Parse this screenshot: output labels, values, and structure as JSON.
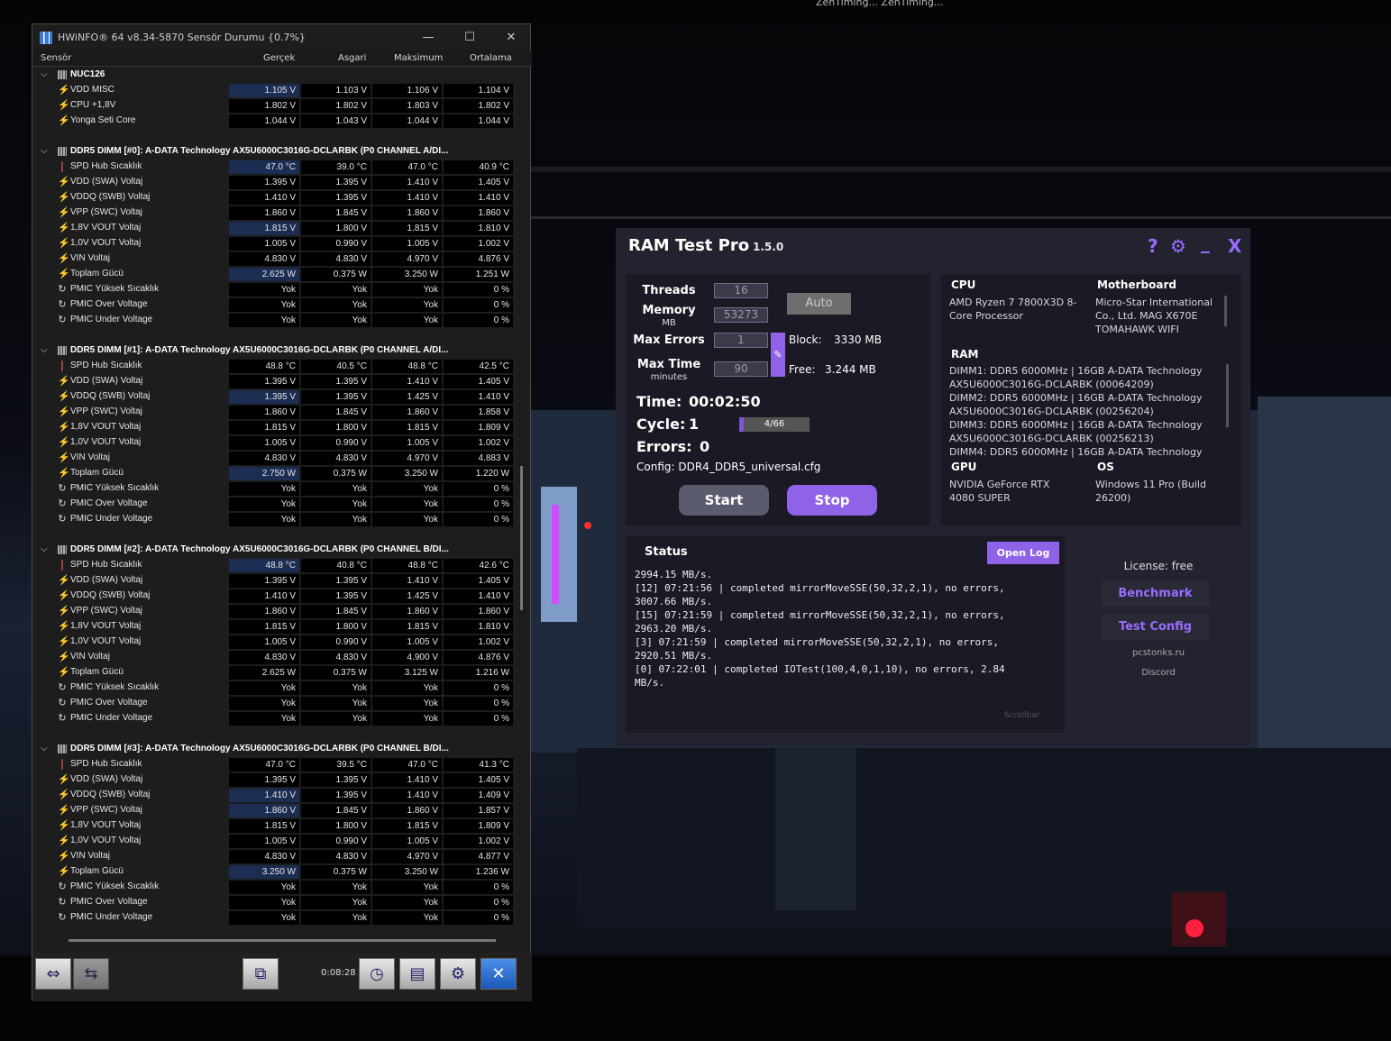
{
  "desktop": {
    "top_text": "ZenTiming...  ZenTiming..."
  },
  "hwinfo": {
    "title": "HWiNFO® 64 v8.34-5870 Sensör Durumu {0.7%}",
    "columns": [
      "Sensör",
      "Gerçek",
      "Asgari",
      "Maksimum",
      "Ortalama"
    ],
    "groups": [
      {
        "name": "NUC126",
        "rows": [
          {
            "i": "bolt",
            "n": "VDD MISC",
            "v": [
              "1.105 V",
              "1.103 V",
              "1.106 V",
              "1.104 V"
            ],
            "h": true
          },
          {
            "i": "bolt",
            "n": "CPU +1,8V",
            "v": [
              "1.802 V",
              "1.802 V",
              "1.803 V",
              "1.802 V"
            ]
          },
          {
            "i": "bolt",
            "n": "Yonga Seti Core",
            "v": [
              "1.044 V",
              "1.043 V",
              "1.044 V",
              "1.044 V"
            ]
          }
        ]
      },
      {
        "name": "DDR5 DIMM [#0]: A-DATA Technology AX5U6000C3016G-DCLARBK (P0 CHANNEL A/DI...",
        "rows": [
          {
            "i": "therm",
            "n": "SPD Hub Sıcaklık",
            "v": [
              "47.0 °C",
              "39.0 °C",
              "47.0 °C",
              "40.9 °C"
            ],
            "h": true
          },
          {
            "i": "bolt",
            "n": "VDD (SWA) Voltaj",
            "v": [
              "1.395 V",
              "1.395 V",
              "1.410 V",
              "1.405 V"
            ]
          },
          {
            "i": "bolt",
            "n": "VDDQ (SWB) Voltaj",
            "v": [
              "1.410 V",
              "1.395 V",
              "1.410 V",
              "1.410 V"
            ]
          },
          {
            "i": "bolt",
            "n": "VPP (SWC) Voltaj",
            "v": [
              "1.860 V",
              "1.845 V",
              "1.860 V",
              "1.860 V"
            ]
          },
          {
            "i": "bolt",
            "n": "1,8V VOUT Voltaj",
            "v": [
              "1.815 V",
              "1.800 V",
              "1.815 V",
              "1.810 V"
            ],
            "h": true
          },
          {
            "i": "bolt",
            "n": "1,0V VOUT Voltaj",
            "v": [
              "1.005 V",
              "0.990 V",
              "1.005 V",
              "1.002 V"
            ]
          },
          {
            "i": "bolt",
            "n": "VIN Voltaj",
            "v": [
              "4.830 V",
              "4.830 V",
              "4.970 V",
              "4.876 V"
            ]
          },
          {
            "i": "bolt",
            "n": "Toplam Gücü",
            "v": [
              "2.625 W",
              "0.375 W",
              "3.250 W",
              "1.251 W"
            ],
            "h": true
          },
          {
            "i": "circ",
            "n": "PMIC Yüksek Sıcaklık",
            "v": [
              "Yok",
              "Yok",
              "Yok",
              "0 %"
            ]
          },
          {
            "i": "circ",
            "n": "PMIC Over Voltage",
            "v": [
              "Yok",
              "Yok",
              "Yok",
              "0 %"
            ]
          },
          {
            "i": "circ",
            "n": "PMIC Under Voltage",
            "v": [
              "Yok",
              "Yok",
              "Yok",
              "0 %"
            ]
          }
        ]
      },
      {
        "name": "DDR5 DIMM [#1]: A-DATA Technology AX5U6000C3016G-DCLARBK (P0 CHANNEL A/DI...",
        "rows": [
          {
            "i": "therm",
            "n": "SPD Hub Sıcaklık",
            "v": [
              "48.8 °C",
              "40.5 °C",
              "48.8 °C",
              "42.5 °C"
            ]
          },
          {
            "i": "bolt",
            "n": "VDD (SWA) Voltaj",
            "v": [
              "1.395 V",
              "1.395 V",
              "1.410 V",
              "1.405 V"
            ]
          },
          {
            "i": "bolt",
            "n": "VDDQ (SWB) Voltaj",
            "v": [
              "1.395 V",
              "1.395 V",
              "1.425 V",
              "1.410 V"
            ],
            "h": true
          },
          {
            "i": "bolt",
            "n": "VPP (SWC) Voltaj",
            "v": [
              "1.860 V",
              "1.845 V",
              "1.860 V",
              "1.858 V"
            ]
          },
          {
            "i": "bolt",
            "n": "1,8V VOUT Voltaj",
            "v": [
              "1.815 V",
              "1.800 V",
              "1.815 V",
              "1.809 V"
            ]
          },
          {
            "i": "bolt",
            "n": "1,0V VOUT Voltaj",
            "v": [
              "1.005 V",
              "0.990 V",
              "1.005 V",
              "1.002 V"
            ]
          },
          {
            "i": "bolt",
            "n": "VIN Voltaj",
            "v": [
              "4.830 V",
              "4.830 V",
              "4.970 V",
              "4.883 V"
            ]
          },
          {
            "i": "bolt",
            "n": "Toplam Gücü",
            "v": [
              "2.750 W",
              "0.375 W",
              "3.250 W",
              "1.220 W"
            ],
            "h": true
          },
          {
            "i": "circ",
            "n": "PMIC Yüksek Sıcaklık",
            "v": [
              "Yok",
              "Yok",
              "Yok",
              "0 %"
            ]
          },
          {
            "i": "circ",
            "n": "PMIC Over Voltage",
            "v": [
              "Yok",
              "Yok",
              "Yok",
              "0 %"
            ]
          },
          {
            "i": "circ",
            "n": "PMIC Under Voltage",
            "v": [
              "Yok",
              "Yok",
              "Yok",
              "0 %"
            ]
          }
        ]
      },
      {
        "name": "DDR5 DIMM [#2]: A-DATA Technology AX5U6000C3016G-DCLARBK (P0 CHANNEL B/DI...",
        "rows": [
          {
            "i": "therm",
            "n": "SPD Hub Sıcaklık",
            "v": [
              "48.8 °C",
              "40.8 °C",
              "48.8 °C",
              "42.6 °C"
            ],
            "h": true
          },
          {
            "i": "bolt",
            "n": "VDD (SWA) Voltaj",
            "v": [
              "1.395 V",
              "1.395 V",
              "1.410 V",
              "1.405 V"
            ]
          },
          {
            "i": "bolt",
            "n": "VDDQ (SWB) Voltaj",
            "v": [
              "1.410 V",
              "1.395 V",
              "1.425 V",
              "1.410 V"
            ]
          },
          {
            "i": "bolt",
            "n": "VPP (SWC) Voltaj",
            "v": [
              "1.860 V",
              "1.845 V",
              "1.860 V",
              "1.860 V"
            ]
          },
          {
            "i": "bolt",
            "n": "1,8V VOUT Voltaj",
            "v": [
              "1.815 V",
              "1.800 V",
              "1.815 V",
              "1.810 V"
            ]
          },
          {
            "i": "bolt",
            "n": "1,0V VOUT Voltaj",
            "v": [
              "1.005 V",
              "0.990 V",
              "1.005 V",
              "1.002 V"
            ]
          },
          {
            "i": "bolt",
            "n": "VIN Voltaj",
            "v": [
              "4.830 V",
              "4.830 V",
              "4.900 V",
              "4.876 V"
            ]
          },
          {
            "i": "bolt",
            "n": "Toplam Gücü",
            "v": [
              "2.625 W",
              "0.375 W",
              "3.125 W",
              "1.216 W"
            ]
          },
          {
            "i": "circ",
            "n": "PMIC Yüksek Sıcaklık",
            "v": [
              "Yok",
              "Yok",
              "Yok",
              "0 %"
            ]
          },
          {
            "i": "circ",
            "n": "PMIC Over Voltage",
            "v": [
              "Yok",
              "Yok",
              "Yok",
              "0 %"
            ]
          },
          {
            "i": "circ",
            "n": "PMIC Under Voltage",
            "v": [
              "Yok",
              "Yok",
              "Yok",
              "0 %"
            ]
          }
        ]
      },
      {
        "name": "DDR5 DIMM [#3]: A-DATA Technology AX5U6000C3016G-DCLARBK (P0 CHANNEL B/DI...",
        "rows": [
          {
            "i": "therm",
            "n": "SPD Hub Sıcaklık",
            "v": [
              "47.0 °C",
              "39.5 °C",
              "47.0 °C",
              "41.3 °C"
            ]
          },
          {
            "i": "bolt",
            "n": "VDD (SWA) Voltaj",
            "v": [
              "1.395 V",
              "1.395 V",
              "1.410 V",
              "1.405 V"
            ]
          },
          {
            "i": "bolt",
            "n": "VDDQ (SWB) Voltaj",
            "v": [
              "1.410 V",
              "1.395 V",
              "1.410 V",
              "1.409 V"
            ],
            "h": true
          },
          {
            "i": "bolt",
            "n": "VPP (SWC) Voltaj",
            "v": [
              "1.860 V",
              "1.845 V",
              "1.860 V",
              "1.857 V"
            ],
            "h": true
          },
          {
            "i": "bolt",
            "n": "1,8V VOUT Voltaj",
            "v": [
              "1.815 V",
              "1.800 V",
              "1.815 V",
              "1.809 V"
            ]
          },
          {
            "i": "bolt",
            "n": "1,0V VOUT Voltaj",
            "v": [
              "1.005 V",
              "0.990 V",
              "1.005 V",
              "1.002 V"
            ]
          },
          {
            "i": "bolt",
            "n": "VIN Voltaj",
            "v": [
              "4.830 V",
              "4.830 V",
              "4.970 V",
              "4.877 V"
            ]
          },
          {
            "i": "bolt",
            "n": "Toplam Gücü",
            "v": [
              "3.250 W",
              "0.375 W",
              "3.250 W",
              "1.236 W"
            ],
            "h": true
          },
          {
            "i": "circ",
            "n": "PMIC Yüksek Sıcaklık",
            "v": [
              "Yok",
              "Yok",
              "Yok",
              "0 %"
            ]
          },
          {
            "i": "circ",
            "n": "PMIC Over Voltage",
            "v": [
              "Yok",
              "Yok",
              "Yok",
              "0 %"
            ]
          },
          {
            "i": "circ",
            "n": "PMIC Under Voltage",
            "v": [
              "Yok",
              "Yok",
              "Yok",
              "0 %"
            ]
          }
        ]
      }
    ],
    "footer": {
      "elapsed": "0:08:28"
    }
  },
  "ramtest": {
    "title": "RAM Test Pro",
    "version": "1.5.0",
    "icons": [
      "help-icon",
      "settings-icon",
      "minimize-icon",
      "close-icon"
    ],
    "title_icons": {
      "help": "?",
      "settings": "⚙",
      "minimize": "_",
      "close": "X"
    },
    "accent": "#8f63e8",
    "settings": {
      "threads_label": "Threads",
      "threads_value": "16",
      "memory_label": "Memory",
      "memory_unit": "MB",
      "memory_value": "53273",
      "max_errors_label": "Max Errors",
      "max_errors_value": "1",
      "max_time_label": "Max Time",
      "max_time_unit": "minutes",
      "max_time_value": "90",
      "auto_label": "Auto",
      "block_label": "Block:",
      "block_value": "3330 MB",
      "free_label": "Free:",
      "free_value": "3.244 MB"
    },
    "run": {
      "time_label": "Time:",
      "time_value": "00:02:50",
      "cycle_label": "Cycle:",
      "cycle_value": "1",
      "cycle_progress": "4/66",
      "cycle_fraction": 0.06,
      "errors_label": "Errors:",
      "errors_value": "0",
      "config": "Config: DDR4_DDR5_universal.cfg",
      "start_label": "Start",
      "stop_label": "Stop"
    },
    "system": {
      "cpu_label": "CPU",
      "cpu_value": "AMD Ryzen 7 7800X3D 8-\nCore Processor",
      "mb_label": "Motherboard",
      "mb_value": "Micro-Star International\nCo., Ltd. MAG X670E\nTOMAHAWK WIFI",
      "ram_label": "RAM",
      "ram_value": "DIMM1: DDR5 6000MHz | 16GB A-DATA Technology\nAX5U6000C3016G-DCLARBK (00064209)\nDIMM2: DDR5 6000MHz | 16GB A-DATA Technology\nAX5U6000C3016G-DCLARBK (00256204)\nDIMM3: DDR5 6000MHz | 16GB A-DATA Technology\nAX5U6000C3016G-DCLARBK (00256213)\nDIMM4: DDR5 6000MHz | 16GB A-DATA Technology",
      "gpu_label": "GPU",
      "gpu_value": "NVIDIA GeForce RTX\n4080 SUPER",
      "os_label": "OS",
      "os_value": "Windows 11 Pro (Build\n26200)"
    },
    "status": {
      "label": "Status",
      "open_log": "Open Log",
      "scrollbar_hint": "Scrollbar",
      "log": "2994.15 MB/s.\n[12] 07:21:56 | completed mirrorMoveSSE(50,32,2,1), no errors,\n3007.66 MB/s.\n[15] 07:21:59 | completed mirrorMoveSSE(50,32,2,1), no errors,\n2963.20 MB/s.\n[3] 07:21:59 | completed mirrorMoveSSE(50,32,2,1), no errors,\n2920.51 MB/s.\n[0] 07:22:01 | completed IOTest(100,4,0,1,10), no errors, 2.84\nMB/s."
    },
    "side": {
      "license": "License: free",
      "benchmark": "Benchmark",
      "test_config": "Test Config",
      "site": "pcstonks.ru",
      "discord": "Discord"
    }
  }
}
